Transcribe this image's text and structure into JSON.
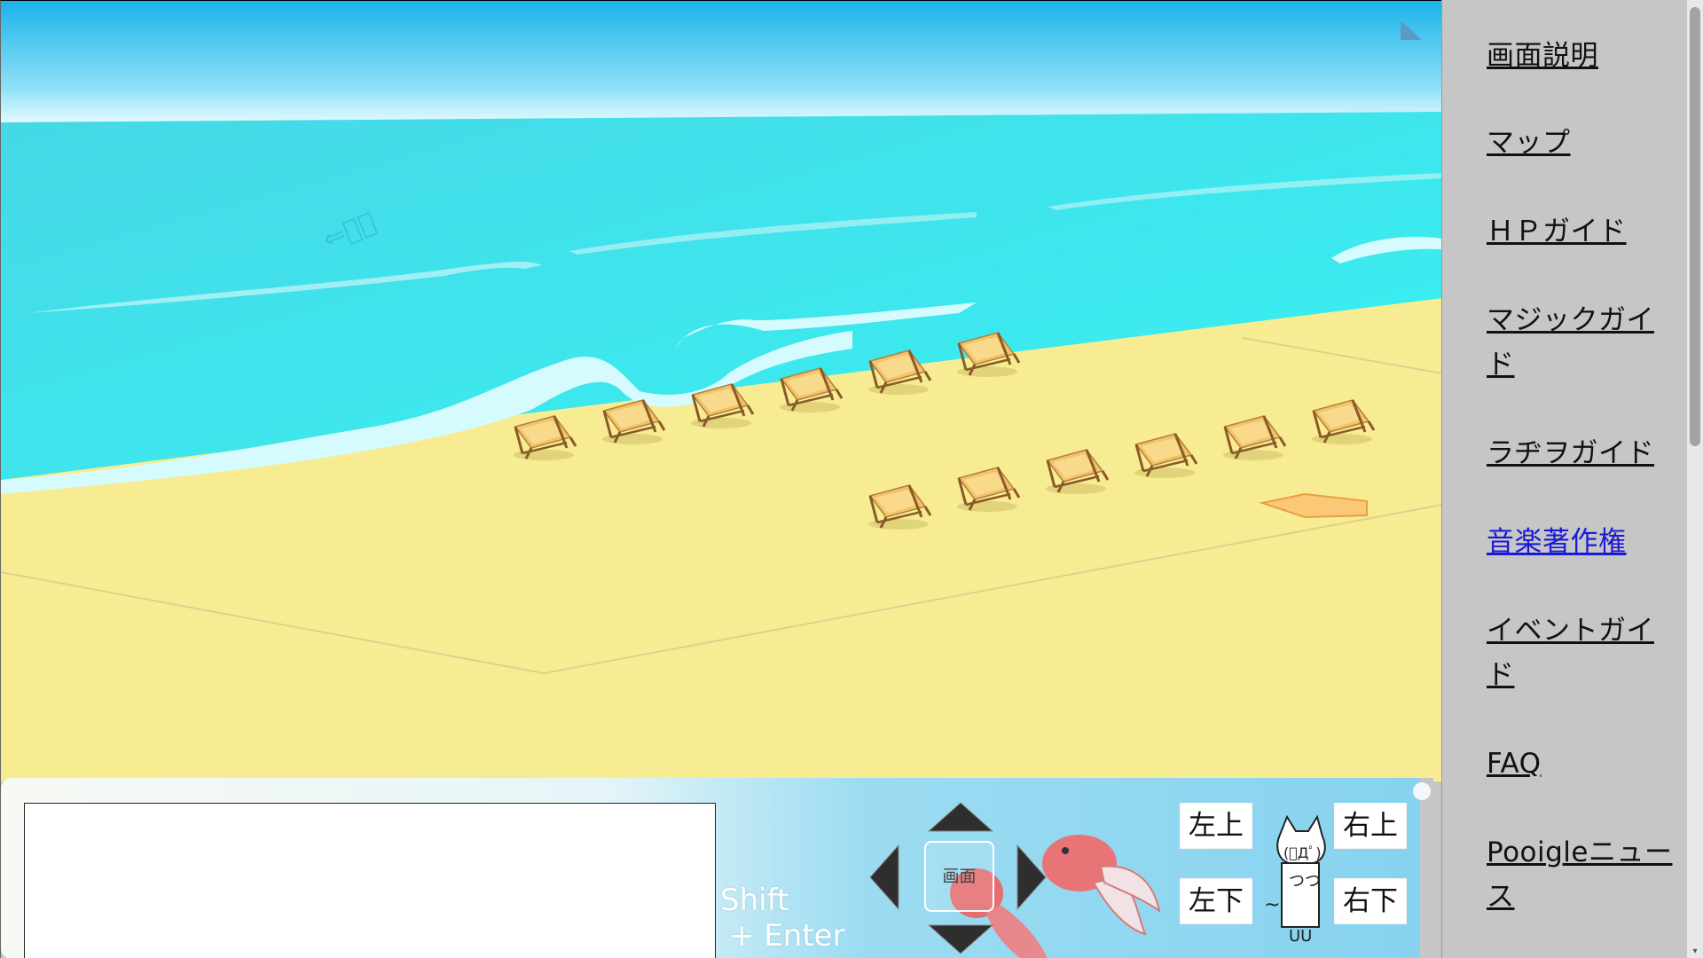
{
  "sidebar": {
    "items": [
      {
        "label": "画面説明",
        "active": false
      },
      {
        "label": "マップ",
        "active": false
      },
      {
        "label": "ＨＰガイド",
        "active": false
      },
      {
        "label": "マジックガイド",
        "active": false
      },
      {
        "label": "ラヂヲガイド",
        "active": false
      },
      {
        "label": "音楽著作権",
        "active": true
      },
      {
        "label": "イベントガイド",
        "active": false
      },
      {
        "label": "FAQ",
        "active": false
      },
      {
        "label": "Pooigleニュース",
        "active": false
      }
    ]
  },
  "chat": {
    "input_value": "",
    "hint_line1": "Shift",
    "hint_line2": "+ Enter"
  },
  "controls": {
    "screen_label": "画面",
    "up_left": "左上",
    "up_right": "右上",
    "down_left": "左下",
    "down_right": "右下"
  },
  "colors": {
    "sky_top": "#1fb8ec",
    "sea": "#3fe0ea",
    "sand": "#f8ec92",
    "panel": "#8fd6f0",
    "link_active": "#1a1ad6"
  },
  "icons": [
    "corner-marker-icon",
    "deck-chair-icon",
    "exit-arrow-icon",
    "dpad-up-icon",
    "dpad-down-icon",
    "dpad-left-icon",
    "dpad-right-icon",
    "goldfish-icon",
    "cat-mascot-icon"
  ]
}
